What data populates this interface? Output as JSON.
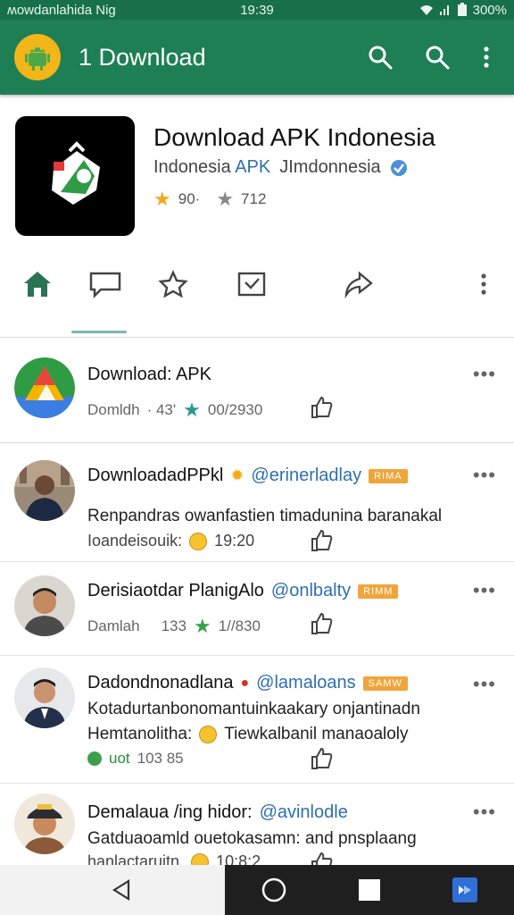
{
  "status_bar": {
    "carrier": "ʍowdanlahida Nig",
    "time": "19:39",
    "battery": "300%"
  },
  "app_bar": {
    "title": "1 Download",
    "icons": [
      "android-logo-icon",
      "search-icon",
      "search-icon",
      "more-vert-icon"
    ]
  },
  "app": {
    "name": "Download APK Indonesia",
    "developer_plain": "Indonesia",
    "developer_accent": "APK",
    "category": "JImdonnesia",
    "rating": "90·",
    "downloads": "712"
  },
  "action_tabs": [
    "home-icon",
    "message-icon",
    "star-icon",
    "inbox-icon",
    "share-icon",
    "more-vert-icon"
  ],
  "apk_item": {
    "title": "Download: APK",
    "meta_label": "Domldh",
    "meta_count": "· 43'",
    "meta_date": "00/2930"
  },
  "posts": [
    {
      "name": "DownloadadPPkl",
      "handle": "@erinerladlay",
      "tag": "RIMA",
      "line1": "Renpandras owanfastien timadunina baranakal",
      "line2": "Ioandeisouik:",
      "time": "19:20"
    },
    {
      "name": "Derisiaotdar PlanigAlo",
      "handle": "@onlbalty",
      "tag": "RIMM",
      "meta_label": "Damlah",
      "meta_count": "133",
      "meta_date": "1//830"
    },
    {
      "name": "Dadondnonadlana",
      "handle": "@lamaloans",
      "tag": "SAMW",
      "line1": "Kotadurtanbonomantuinkaakary onjantinadn",
      "line2": "Hemtanolitha:",
      "line2_extra": "Tiewkalbanil manaoaloly",
      "meta_label": "uot",
      "meta_count": "103 85"
    },
    {
      "name": "Demalaua /ing hidor:",
      "handle": "@avinlodle",
      "line1": "Gatduaoamld ouetokasamn: and pnsplaang",
      "line2": "hanlactaruitn.",
      "time": "10:8:2"
    }
  ],
  "colors": {
    "app_bar": "#1e7f55",
    "accent_blue": "#2e6fb0",
    "tag_orange": "#f0a53a",
    "star": "#f4a81c"
  }
}
